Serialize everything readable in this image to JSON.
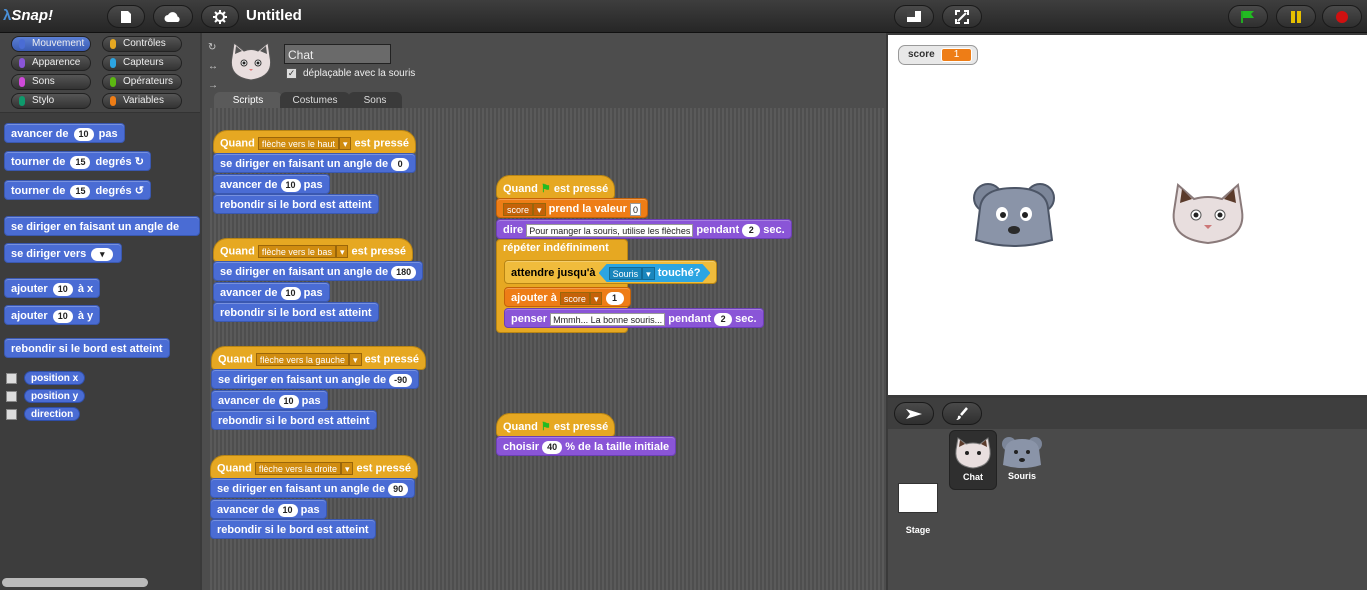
{
  "topbar": {
    "logo_text": "Snap!",
    "title": "Untitled"
  },
  "palette": {
    "categories": [
      {
        "label": "Mouvement",
        "color": "#4a6cd4",
        "selected": true
      },
      {
        "label": "Contrôles",
        "color": "#e6a822",
        "selected": false
      },
      {
        "label": "Apparence",
        "color": "#8a55d7",
        "selected": false
      },
      {
        "label": "Capteurs",
        "color": "#2ca5e2",
        "selected": false
      },
      {
        "label": "Sons",
        "color": "#cf4ad9",
        "selected": false
      },
      {
        "label": "Opérateurs",
        "color": "#5cb712",
        "selected": false
      },
      {
        "label": "Stylo",
        "color": "#0e9a6c",
        "selected": false
      },
      {
        "label": "Variables",
        "color": "#ee7d16",
        "selected": false
      }
    ],
    "blocks": {
      "avancer": {
        "pre": "avancer de",
        "val": "10",
        "post": "pas"
      },
      "tourner_cw": {
        "pre": "tourner de",
        "val": "15",
        "post": "degrés"
      },
      "tourner_ccw": {
        "pre": "tourner de",
        "val": "15",
        "post": "degrés"
      },
      "diriger_angle": "se diriger en faisant un angle de",
      "diriger_vers": "se diriger vers",
      "ajouter_x": {
        "pre": "ajouter",
        "val": "10",
        "post": "à x"
      },
      "ajouter_y": {
        "pre": "ajouter",
        "val": "10",
        "post": "à y"
      },
      "rebondir": "rebondir si le bord est atteint",
      "reporters": [
        "position x",
        "position y",
        "direction"
      ]
    }
  },
  "sprite": {
    "name": "Chat",
    "draggable_label": "déplaçable avec la souris",
    "draggable_checked": true
  },
  "tabs": [
    "Scripts",
    "Costumes",
    "Sons"
  ],
  "scripts": {
    "when_key": "Quand",
    "pressed": "est pressé",
    "keys": [
      "flèche vers le haut",
      "flèche vers le bas",
      "flèche vers la gauche",
      "flèche vers la droite"
    ],
    "point_dir": "se diriger en faisant un angle de",
    "directions": [
      "0",
      "180",
      "-90",
      "90"
    ],
    "move_pre": "avancer de",
    "move_val": "10",
    "move_post": "pas",
    "bounce": "rebondir si le bord est atteint",
    "set_var_label": "prend la valeur",
    "set_var_name": "score",
    "set_var_value": "0",
    "say": "dire",
    "say_text": "Pour manger la souris, utilise les flèches",
    "say_for": "pendant",
    "say_secs": "2",
    "secs_label": "sec.",
    "forever": "répéter indéfiniment",
    "wait_until": "attendre jusqu'à",
    "touching_target": "Souris",
    "touching_label": "touché?",
    "change_label": "ajouter à",
    "change_var": "score",
    "change_val": "1",
    "think": "penser",
    "think_text": "Mmmh... La bonne souris...",
    "think_secs": "2",
    "size_pre": "choisir",
    "size_val": "40",
    "size_post": "% de la taille initiale"
  },
  "stage": {
    "watcher_label": "score",
    "watcher_value": "1"
  },
  "corral": {
    "sprites": [
      "Chat",
      "Souris"
    ],
    "stage_label": "Stage"
  }
}
